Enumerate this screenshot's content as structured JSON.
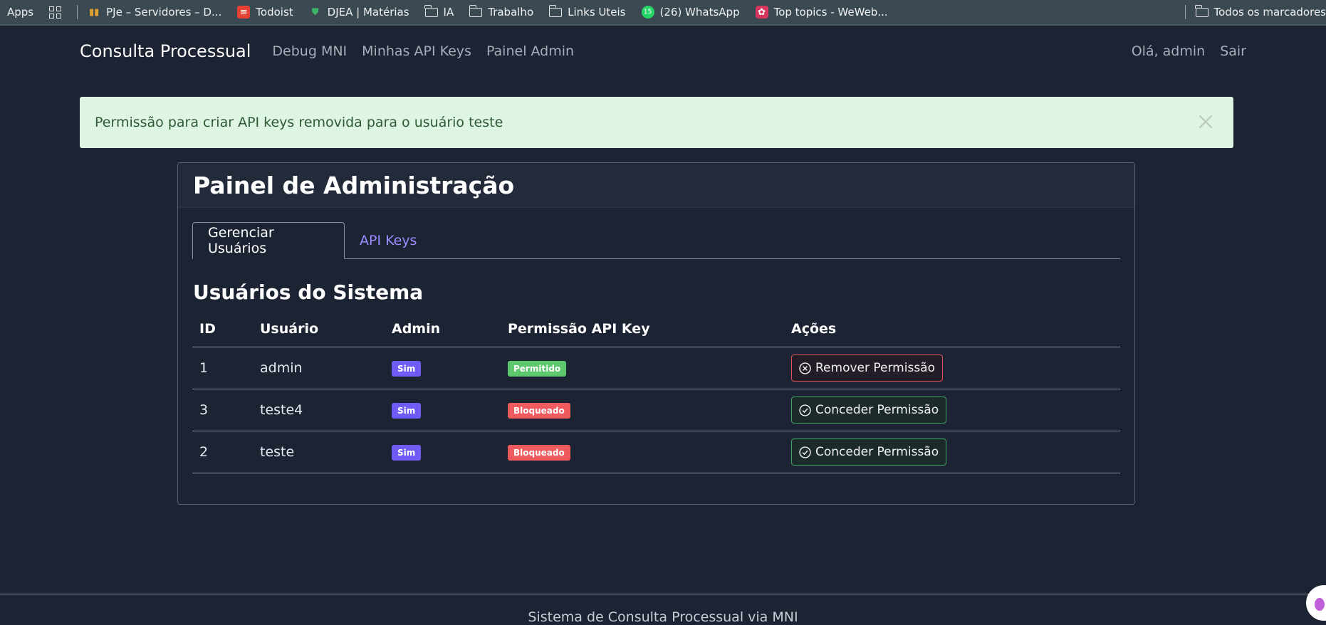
{
  "bookmarks": [
    {
      "label": "Apps",
      "icon": "apps-icon"
    },
    {
      "label": "",
      "icon": "grid-icon"
    },
    {
      "label": "PJe – Servidores – D...",
      "icon": "chart-icon"
    },
    {
      "label": "Todoist",
      "icon": "todoist-icon"
    },
    {
      "label": "DJEA | Matérias",
      "icon": "shield-icon"
    },
    {
      "label": "IA",
      "icon": "folder-icon"
    },
    {
      "label": "Trabalho",
      "icon": "folder-icon"
    },
    {
      "label": "Links Uteis",
      "icon": "folder-icon"
    },
    {
      "label": "(26) WhatsApp",
      "icon": "whatsapp-icon",
      "badge": "15"
    },
    {
      "label": "Top topics - WeWeb...",
      "icon": "weweb-icon"
    }
  ],
  "bookmarks_right": {
    "label": "Todos os marcadores"
  },
  "navbar": {
    "brand": "Consulta Processual",
    "links": [
      "Debug MNI",
      "Minhas API Keys",
      "Painel Admin"
    ],
    "greeting": "Olá, admin",
    "logout": "Sair"
  },
  "alert": {
    "message": "Permissão para criar API keys removida para o usuário teste"
  },
  "card": {
    "title": "Painel de Administração",
    "tabs": [
      "Gerenciar Usuários",
      "API Keys"
    ],
    "active_tab": "Gerenciar Usuários",
    "section_title": "Usuários do Sistema",
    "columns": [
      "ID",
      "Usuário",
      "Admin",
      "Permissão API Key",
      "Ações"
    ],
    "rows": [
      {
        "id": "1",
        "user": "admin",
        "admin": "Sim",
        "permission": "Permitido",
        "permission_status": "allowed",
        "action": "Remover Permissão",
        "action_type": "remove"
      },
      {
        "id": "3",
        "user": "teste4",
        "admin": "Sim",
        "permission": "Bloqueado",
        "permission_status": "blocked",
        "action": "Conceder Permissão",
        "action_type": "grant"
      },
      {
        "id": "2",
        "user": "teste",
        "admin": "Sim",
        "permission": "Bloqueado",
        "permission_status": "blocked",
        "action": "Conceder Permissão",
        "action_type": "grant"
      }
    ]
  },
  "footer": {
    "text": "Sistema de Consulta Processual via MNI"
  },
  "colors": {
    "background": "#1c2333",
    "alert_bg": "#dff5e3",
    "badge_admin": "#6f5cf6",
    "badge_allowed": "#5cc76d",
    "badge_blocked": "#ef5a5f",
    "tab_link": "#9c8cff"
  }
}
